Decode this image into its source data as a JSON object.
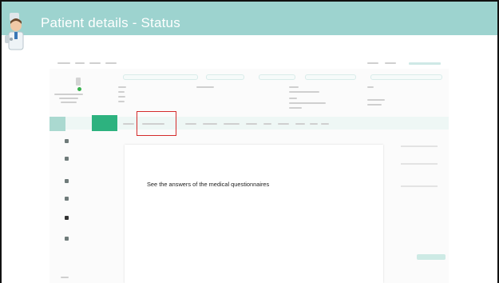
{
  "slide": {
    "title": "Patient details - Status"
  },
  "callout": {
    "text": "See the answers of the medical questionnaires"
  },
  "colors": {
    "header": "#9dd3cf",
    "accent": "#2db27f",
    "highlight": "#d42b2b"
  },
  "icons": {
    "doctor": "doctor-avatar-icon"
  }
}
